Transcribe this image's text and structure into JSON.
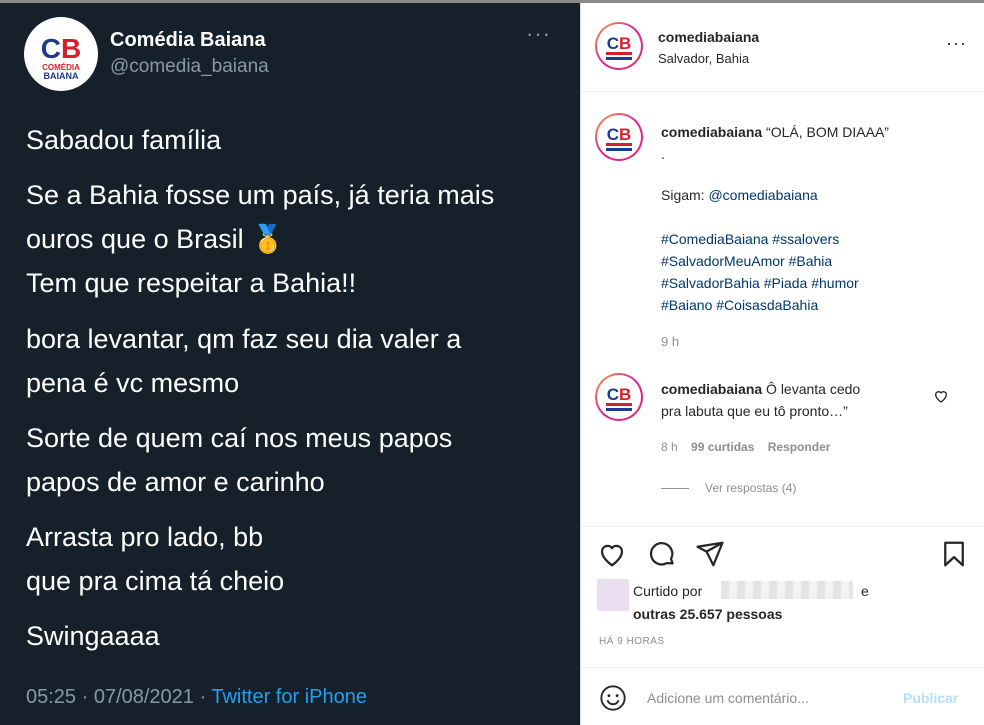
{
  "tweet": {
    "name": "Comédia Baiana",
    "handle": "@comedia_baiana",
    "more": "···",
    "logo": {
      "letters": "CB",
      "line1": "COMÉDIA",
      "line2": "BAIANA"
    },
    "lines": [
      "Sabadou família",
      "Se a Bahia fosse um país, já teria mais",
      "ouros que o Brasil 🥇",
      "Tem que respeitar a Bahia!!",
      "bora levantar, qm faz  seu dia valer a",
      "pena é vc mesmo",
      "Sorte de quem caí nos meus papos",
      "papos de amor e carinho",
      "Arrasta pro lado, bb",
      "que pra cima tá cheio",
      "Swingaaaa"
    ],
    "meta_time": "05:25 · 07/08/2021 · ",
    "meta_source": "Twitter for iPhone"
  },
  "instagram": {
    "header": {
      "username": "comediabaiana",
      "location": "Salvador, Bahia",
      "more": "···"
    },
    "caption": {
      "username": "comediabaiana",
      "text": " “OLÁ, BOM DIAAA”",
      "dot": ".",
      "follow_prefix": "Sigam: ",
      "follow_handle": "@comediabaiana",
      "hashtag_lines": [
        "#ComediaBaiana #ssalovers",
        "#SalvadorMeuAmor #Bahia",
        "#SalvadorBahia #Piada #humor",
        "#Baiano #CoisasdaBahia"
      ],
      "time": "9 h"
    },
    "comment": {
      "username": "comediabaiana",
      "text1": " Ô levanta cedo",
      "text2": "pra labuta que eu tô pronto…”",
      "time": "8 h",
      "likes": "99 curtidas",
      "reply": "Responder",
      "view_replies": "Ver respostas (4)"
    },
    "likes": {
      "prefix": "Curtido por",
      "suffix": "e",
      "others": "outras 25.657 pessoas"
    },
    "timestamp": "HÁ 9 HORAS",
    "comment_box": {
      "placeholder": "Adicione um comentário...",
      "post_label": "Publicar"
    }
  },
  "colors": {
    "tweet_bg": "#15202b",
    "tweet_secondary": "#8899a6",
    "twitter_blue": "#1da1f2",
    "ig_link": "#00376b",
    "logo_red": "#d81e2c",
    "logo_blue": "#1d3a8c"
  }
}
